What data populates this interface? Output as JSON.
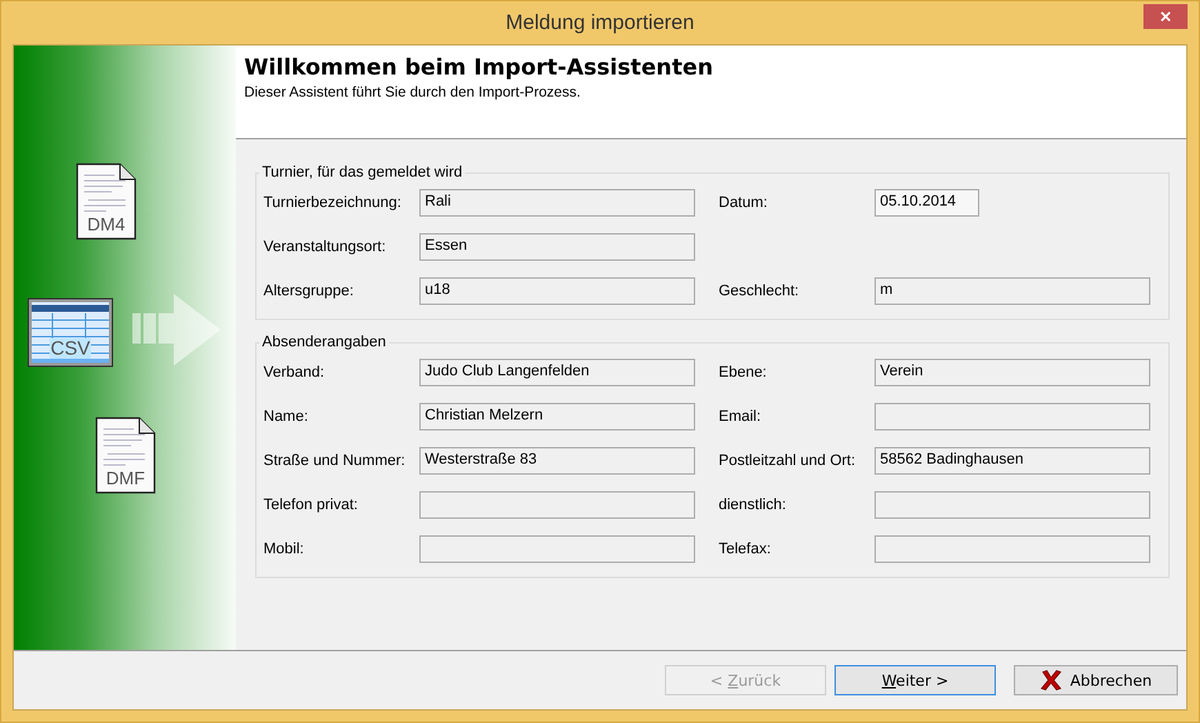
{
  "window": {
    "title": "Meldung importieren",
    "close": "✕"
  },
  "side_icons": [
    {
      "kind": "document",
      "label": "DM4"
    },
    {
      "kind": "table",
      "label": "CSV"
    },
    {
      "kind": "document",
      "label": "DMF"
    }
  ],
  "header": {
    "title": "Willkommen beim Import-Assistenten",
    "subtitle": "Dieser Assistent führt Sie durch den Import-Prozess."
  },
  "groups": [
    {
      "title": "Turnier, für das gemeldet wird",
      "rows": [
        {
          "left": {
            "label": "Turnierbezeichnung:",
            "value": "Rali"
          },
          "right": {
            "label": "Datum:",
            "value": "05.10.2014",
            "kind": "date"
          }
        },
        {
          "left": {
            "label": "Veranstaltungsort:",
            "value": "Essen"
          }
        },
        {
          "left": {
            "label": "Altersgruppe:",
            "value": "u18"
          },
          "right": {
            "label": "Geschlecht:",
            "value": "m",
            "kind": "text"
          }
        }
      ]
    },
    {
      "title": "Absenderangaben",
      "rows": [
        {
          "left": {
            "label": "Verband:",
            "value": "Judo Club Langenfelden"
          },
          "right": {
            "label": "Ebene:",
            "value": "Verein",
            "kind": "text"
          }
        },
        {
          "left": {
            "label": "Name:",
            "value": "Christian Melzern"
          },
          "right": {
            "label": "Email:",
            "kind": "text"
          }
        },
        {
          "left": {
            "label": "Straße und Nummer:",
            "value": "Westerstraße 83"
          },
          "right": {
            "label": "Postleitzahl und Ort:",
            "value": "58562 Badinghausen",
            "kind": "text"
          }
        },
        {
          "left": {
            "label": "Telefon privat:"
          },
          "right": {
            "label": "dienstlich:",
            "kind": "text"
          }
        },
        {
          "left": {
            "label": "Mobil:"
          },
          "right": {
            "label": "Telefax:",
            "kind": "text"
          }
        }
      ]
    }
  ],
  "buttons": [
    {
      "kind": "back",
      "before": "< ",
      "key": "Z",
      "after": "urück",
      "disabled": true,
      "focused": false
    },
    {
      "kind": "next",
      "key": "W",
      "after": "eiter >",
      "disabled": false,
      "focused": true
    },
    {
      "kind": "cancel",
      "after": "Abbrechen",
      "disabled": false,
      "focused": false
    }
  ]
}
